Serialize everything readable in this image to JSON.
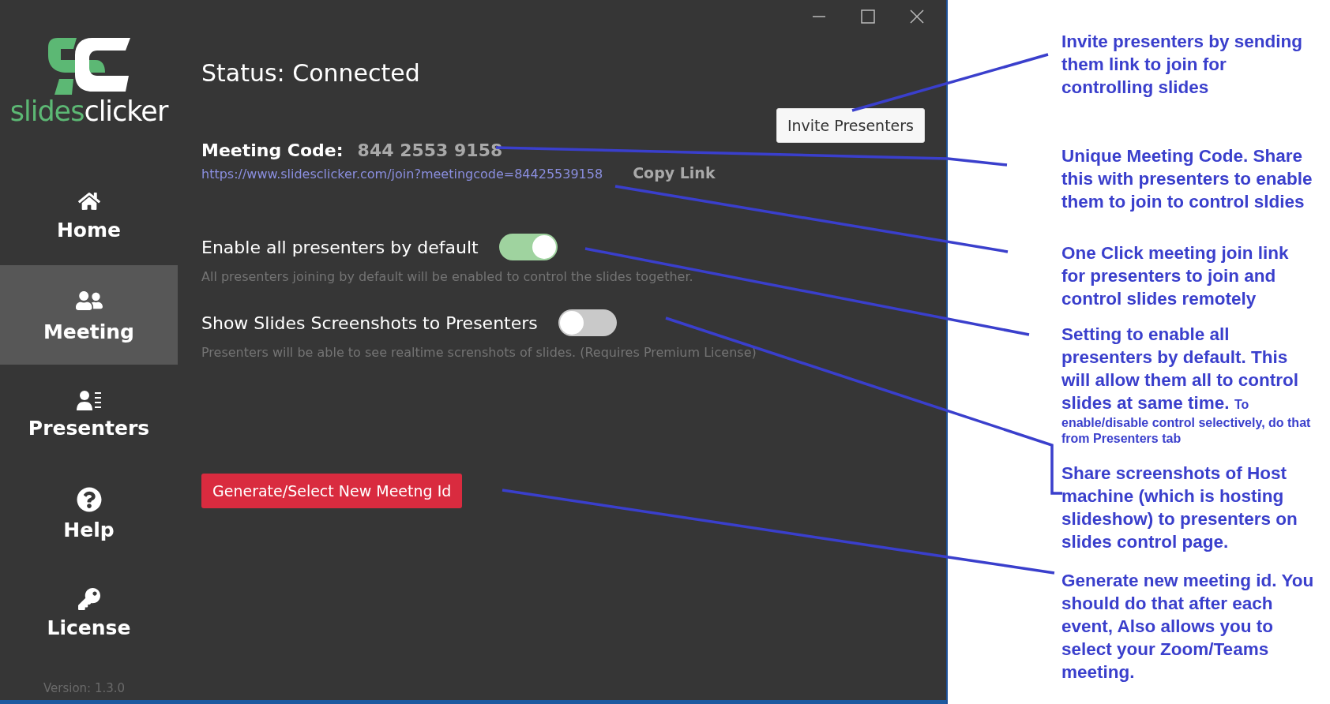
{
  "sidebar": {
    "wordmark": [
      {
        "text": "slides",
        "color": "#5cb874"
      },
      {
        "text": "clicker",
        "color": "#ffffff"
      }
    ],
    "items": [
      {
        "label": "Home",
        "selected": false
      },
      {
        "label": "Meeting",
        "selected": true
      },
      {
        "label": "Presenters",
        "selected": false
      },
      {
        "label": "Help",
        "selected": false
      },
      {
        "label": "License",
        "selected": false
      }
    ],
    "version": "Version: 1.3.0"
  },
  "main": {
    "status": "Status: Connected",
    "invite_button": "Invite Presenters",
    "meeting_code": {
      "label": "Meeting Code:",
      "value": "844 2553 9158"
    },
    "join_link": "https://www.slidesclicker.com/join?meetingcode=84425539158",
    "copy_link": "Copy Link",
    "settings": [
      {
        "label": "Enable all presenters by default",
        "description": "All presenters joining by default will be enabled to control the slides together.",
        "on": true
      },
      {
        "label": "Show Slides Screenshots to Presenters",
        "description": "Presenters will be able to see realtime screnshots of slides. (Requires Premium License)",
        "on": false
      }
    ],
    "generate_button": "Generate/Select New Meetng Id"
  },
  "annotations": [
    {
      "text": "Invite presenters by sending them link to join for controlling slides"
    },
    {
      "text": "Unique Meeting Code. Share this with presenters to enable them to join to control sldies"
    },
    {
      "text": "One Click meeting join link for presenters to join and control slides remotely"
    },
    {
      "text": "Setting to enable all presenters by default. This will allow them all to control slides at same time.",
      "note": "To enable/disable control selectively, do that from Presenters tab"
    },
    {
      "text": "Share screenshots of Host machine (which is hosting slideshow) to presenters on slides control page."
    },
    {
      "text": "Generate new meeting id. You should do that after each event, Also allows you to select your Zoom/Teams meeting."
    }
  ]
}
